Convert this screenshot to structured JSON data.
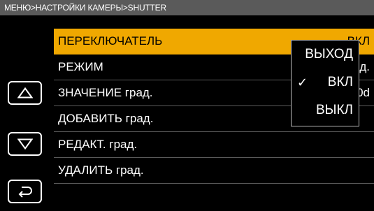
{
  "breadcrumb": "МЕНЮ>НАСТРОЙКИ КАМЕРЫ>SHUTTER",
  "menu": {
    "rows": [
      {
        "label": "ПЕРЕКЛЮЧАТЕЛЬ",
        "value": "ВКЛ"
      },
      {
        "label": "РЕЖИМ",
        "value": "д."
      },
      {
        "label": "ЗНАЧЕНИЕ град.",
        "value": "0d"
      },
      {
        "label": "ДОБАВИТЬ град.",
        "value": ""
      },
      {
        "label": "РЕДАКТ. град.",
        "value": ""
      },
      {
        "label": "УДАЛИТЬ град.",
        "value": ""
      }
    ]
  },
  "dropdown": {
    "options": [
      "ВЫХОД",
      "ВКЛ",
      "ВЫКЛ"
    ],
    "selected": "ВКЛ",
    "check_glyph": "✓"
  },
  "icons": {
    "up": "triangle-up-icon",
    "down": "triangle-down-icon",
    "back": "return-arrow-icon"
  },
  "colors": {
    "highlight": "#f0a800",
    "breadcrumb_bg": "#5a5a5a"
  }
}
